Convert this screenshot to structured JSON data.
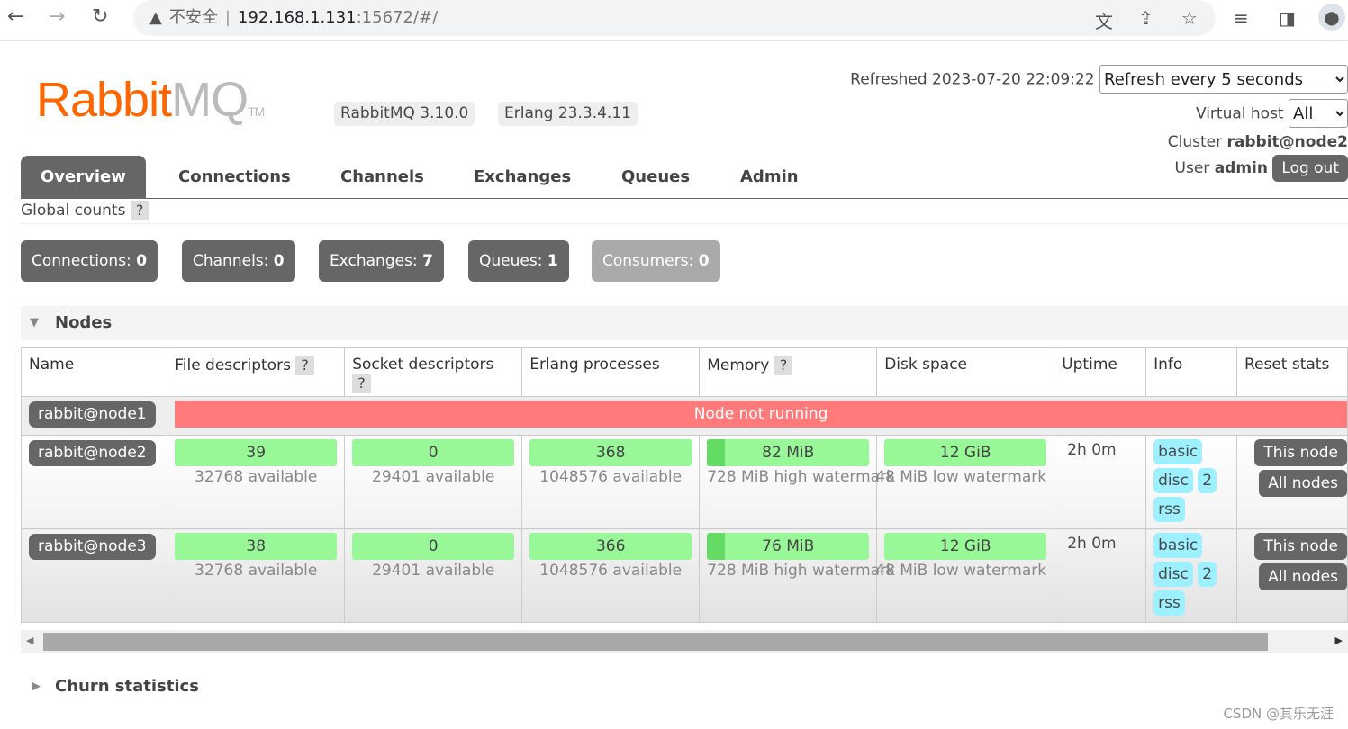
{
  "browser": {
    "insecure_label": "不安全",
    "url_host": "192.168.1.131",
    "url_rest": ":15672/#/"
  },
  "logo": {
    "rabbit": "Rabbit",
    "mq": "MQ",
    "tm": "TM"
  },
  "versions": {
    "rabbitmq": "RabbitMQ 3.10.0",
    "erlang": "Erlang 23.3.4.11"
  },
  "header": {
    "refreshed_label": "Refreshed",
    "refreshed": "2023-07-20 22:09:22",
    "refresh_option": "Refresh every 5 seconds",
    "vhost_label": "Virtual host",
    "vhost_option": "All",
    "cluster_label": "Cluster",
    "cluster": "rabbit@node2",
    "user_label": "User",
    "user": "admin",
    "logout": "Log out"
  },
  "tabs": [
    "Overview",
    "Connections",
    "Channels",
    "Exchanges",
    "Queues",
    "Admin"
  ],
  "global_counts": {
    "label": "Global counts",
    "help": "?",
    "items": [
      {
        "label": "Connections:",
        "value": "0"
      },
      {
        "label": "Channels:",
        "value": "0"
      },
      {
        "label": "Exchanges:",
        "value": "7"
      },
      {
        "label": "Queues:",
        "value": "1"
      },
      {
        "label": "Consumers:",
        "value": "0"
      }
    ]
  },
  "nodes": {
    "title": "Nodes",
    "columns": [
      "Name",
      "File descriptors",
      "Socket descriptors",
      "Erlang processes",
      "Memory",
      "Disk space",
      "Uptime",
      "Info",
      "Reset stats"
    ],
    "help": "?",
    "node1": {
      "name": "rabbit@node1",
      "status": "Node not running"
    },
    "rows": [
      {
        "name": "rabbit@node2",
        "fd": "39",
        "fd_avail": "32768 available",
        "sd": "0",
        "sd_avail": "29401 available",
        "ep": "368",
        "ep_avail": "1048576 available",
        "mem": "82 MiB",
        "mem_fraction": 0.11,
        "mem_sub": "728 MiB high watermark",
        "disk": "12 GiB",
        "disk_sub": "48 MiB low watermark",
        "uptime": "2h 0m",
        "info": [
          "basic",
          "disc",
          "2",
          "rss"
        ],
        "this_node": "This node",
        "all_nodes": "All nodes"
      },
      {
        "name": "rabbit@node3",
        "fd": "38",
        "fd_avail": "32768 available",
        "sd": "0",
        "sd_avail": "29401 available",
        "ep": "366",
        "ep_avail": "1048576 available",
        "mem": "76 MiB",
        "mem_fraction": 0.11,
        "mem_sub": "728 MiB high watermark",
        "disk": "12 GiB",
        "disk_sub": "48 MiB low watermark",
        "uptime": "2h 0m",
        "info": [
          "basic",
          "disc",
          "2",
          "rss"
        ],
        "this_node": "This node",
        "all_nodes": "All nodes"
      }
    ]
  },
  "churn": {
    "title": "Churn statistics"
  },
  "watermark": "CSDN @其乐无涯"
}
